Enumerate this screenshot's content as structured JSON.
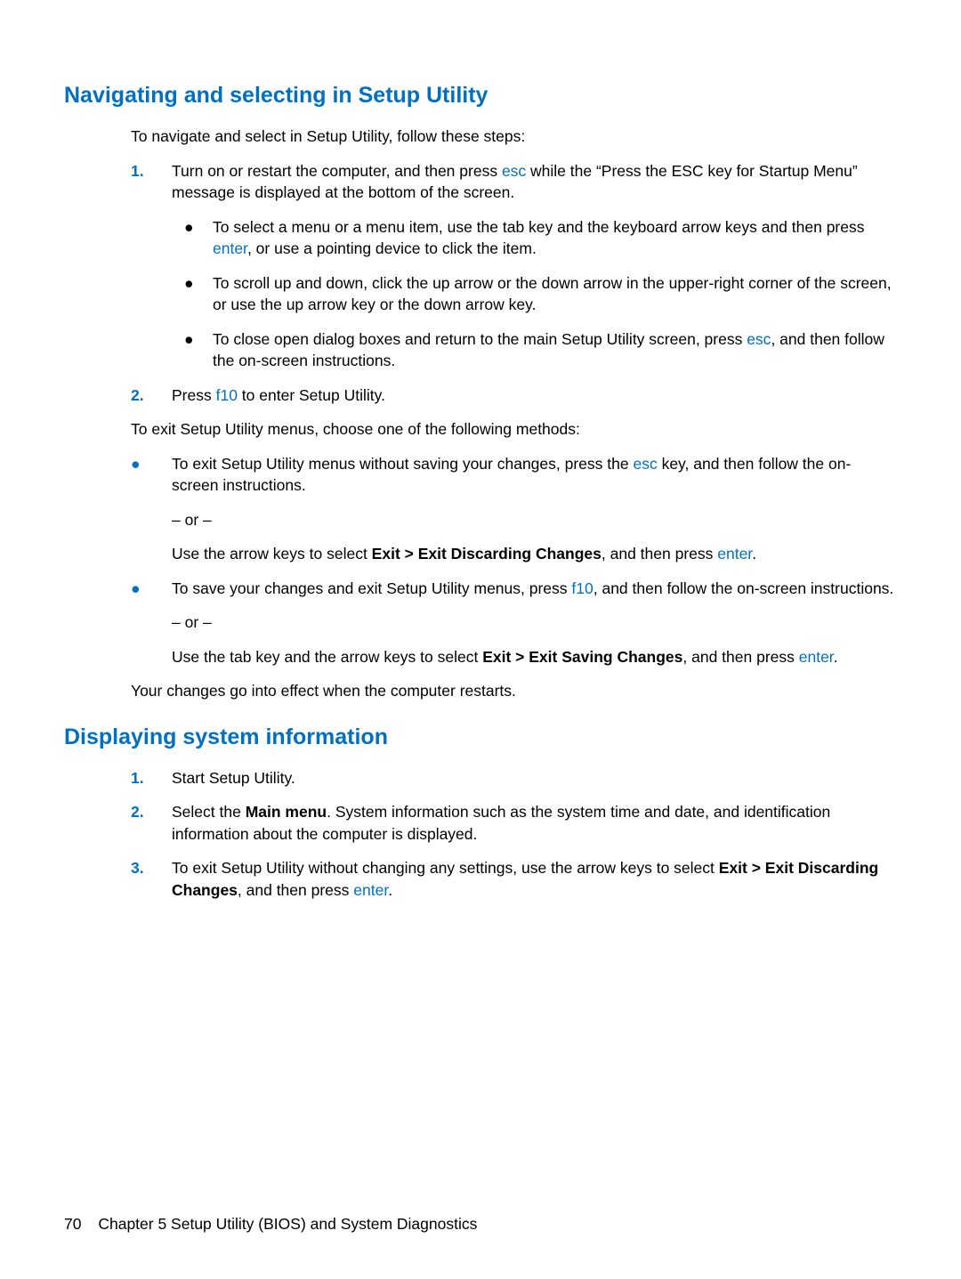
{
  "section1": {
    "heading": "Navigating and selecting in Setup Utility",
    "intro": "To navigate and select in Setup Utility, follow these steps:",
    "step1": {
      "num": "1.",
      "text_a": "Turn on or restart the computer, and then press ",
      "key_esc": "esc",
      "text_b": " while the “Press the ESC key for Startup Menu” message is displayed at the bottom of the screen.",
      "bullets": {
        "b1": {
          "text_a": "To select a menu or a menu item, use the tab key and the keyboard arrow keys and then press ",
          "key_enter": "enter",
          "text_b": ", or use a pointing device to click the item."
        },
        "b2": {
          "text": "To scroll up and down, click the up arrow or the down arrow in the upper-right corner of the screen, or use the up arrow key or the down arrow key."
        },
        "b3": {
          "text_a": "To close open dialog boxes and return to the main Setup Utility screen, press ",
          "key_esc": "esc",
          "text_b": ", and then follow the on-screen instructions."
        }
      }
    },
    "step2": {
      "num": "2.",
      "text_a": "Press ",
      "key_f10": "f10",
      "text_b": " to enter Setup Utility."
    },
    "exit_intro": "To exit Setup Utility menus, choose one of the following methods:",
    "exit_bullets": {
      "e1": {
        "p1_a": "To exit Setup Utility menus without saving your changes, press the ",
        "p1_key": "esc",
        "p1_b": " key, and then follow the on-screen instructions.",
        "or": "– or –",
        "p2_a": "Use the arrow keys to select ",
        "p2_bold": "Exit > Exit Discarding Changes",
        "p2_b": ", and then press ",
        "p2_key": "enter",
        "p2_c": "."
      },
      "e2": {
        "p1_a": "To save your changes and exit Setup Utility menus, press ",
        "p1_key": "f10",
        "p1_b": ", and then follow the on-screen instructions.",
        "or": "– or –",
        "p2_a": "Use the tab key and the arrow keys to select ",
        "p2_bold": "Exit > Exit Saving Changes",
        "p2_b": ", and then press ",
        "p2_key": "enter",
        "p2_c": "."
      }
    },
    "closing": "Your changes go into effect when the computer restarts."
  },
  "section2": {
    "heading": "Displaying system information",
    "step1": {
      "num": "1.",
      "text": "Start Setup Utility."
    },
    "step2": {
      "num": "2.",
      "text_a": "Select the ",
      "bold": "Main menu",
      "text_b": ". System information such as the system time and date, and identification information about the computer is displayed."
    },
    "step3": {
      "num": "3.",
      "text_a": "To exit Setup Utility without changing any settings, use the arrow keys to select ",
      "bold": "Exit > Exit Discarding Changes",
      "text_b": ", and then press ",
      "key_enter": "enter",
      "text_c": "."
    }
  },
  "footer": {
    "page": "70",
    "chapter": "Chapter 5   Setup Utility (BIOS) and System Diagnostics"
  }
}
